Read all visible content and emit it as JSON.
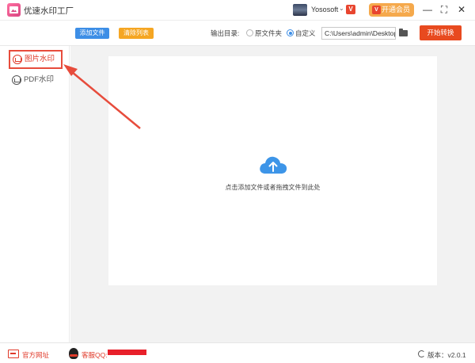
{
  "app": {
    "title": "优速水印工厂"
  },
  "user": {
    "name": "Yososoft",
    "caret": "⌄",
    "badge": "V",
    "vip_label": "开通会员",
    "vip_icon": "V"
  },
  "window": {
    "minimize": "—",
    "maximize": "⛶",
    "close": "✕"
  },
  "toolbar": {
    "add_file": "添加文件",
    "clear_list": "清除列表",
    "output_label": "输出目录:",
    "option_source": "原文件夹",
    "option_custom": "自定义",
    "output_path": "C:\\Users\\admin\\Desktop",
    "start": "开始转换"
  },
  "sidebar": {
    "items": [
      {
        "label": "图片水印",
        "active": true
      },
      {
        "label": "PDF水印",
        "active": false
      }
    ]
  },
  "main": {
    "dropzone_text": "点击添加文件或者拖拽文件到此处"
  },
  "status": {
    "site": "官方网址",
    "qq": "客服QQ:",
    "version": "版本：v2.0.1"
  },
  "colors": {
    "accent_blue": "#3d8ee6",
    "accent_orange": "#f5a623",
    "start_red": "#e84a1f",
    "annotation_red": "#e74c3c"
  }
}
